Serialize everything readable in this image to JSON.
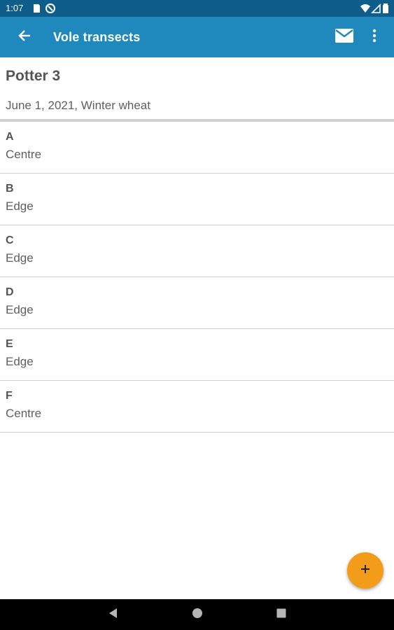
{
  "status_bar": {
    "time": "1:07",
    "icons": [
      "sd-card-icon",
      "sync-icon",
      "wifi-icon",
      "signal-icon",
      "battery-icon"
    ]
  },
  "app_bar": {
    "title": "Vole transects",
    "color": "#1f88bd",
    "status_color": "#0e5d8a"
  },
  "header": {
    "title": "Potter 3",
    "subtitle": "June 1, 2021, Winter wheat"
  },
  "transects": [
    {
      "name": "A",
      "location": "Centre"
    },
    {
      "name": "B",
      "location": "Edge"
    },
    {
      "name": "C",
      "location": "Edge"
    },
    {
      "name": "D",
      "location": "Edge"
    },
    {
      "name": "E",
      "location": "Edge"
    },
    {
      "name": "F",
      "location": "Centre"
    }
  ],
  "fab": {
    "icon": "plus-icon",
    "color": "#f39c19"
  }
}
